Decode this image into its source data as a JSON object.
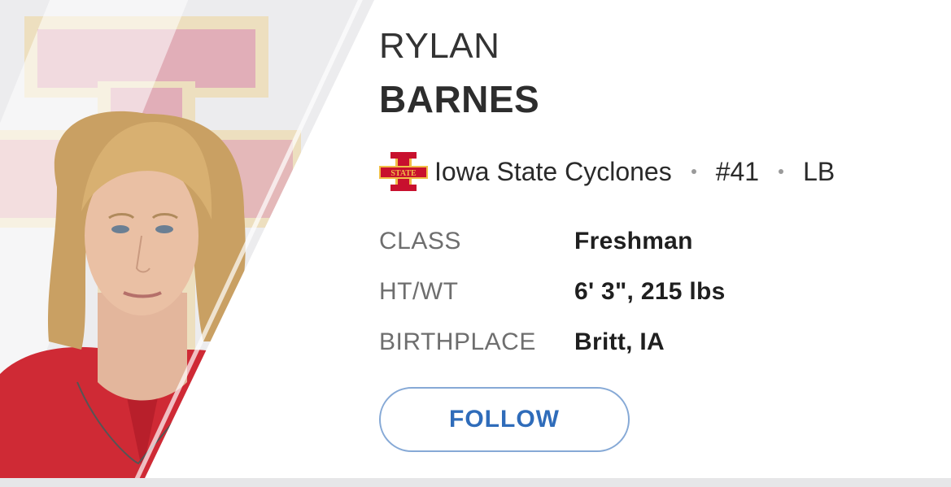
{
  "player": {
    "first_name": "RYLAN",
    "last_name": "BARNES",
    "team": {
      "name": "Iowa State Cyclones",
      "logo_icon": "iowa-state-logo-icon",
      "logo_text": "STATE"
    },
    "number": "#41",
    "position": "LB",
    "attributes": [
      {
        "label": "CLASS",
        "value": "Freshman"
      },
      {
        "label": "HT/WT",
        "value": "6' 3\", 215 lbs"
      },
      {
        "label": "BIRTHPLACE",
        "value": "Britt, IA"
      }
    ]
  },
  "actions": {
    "follow_label": "FOLLOW"
  },
  "colors": {
    "accent": "#2f6cba",
    "team_cardinal": "#c8102e",
    "team_gold": "#f1be48"
  }
}
